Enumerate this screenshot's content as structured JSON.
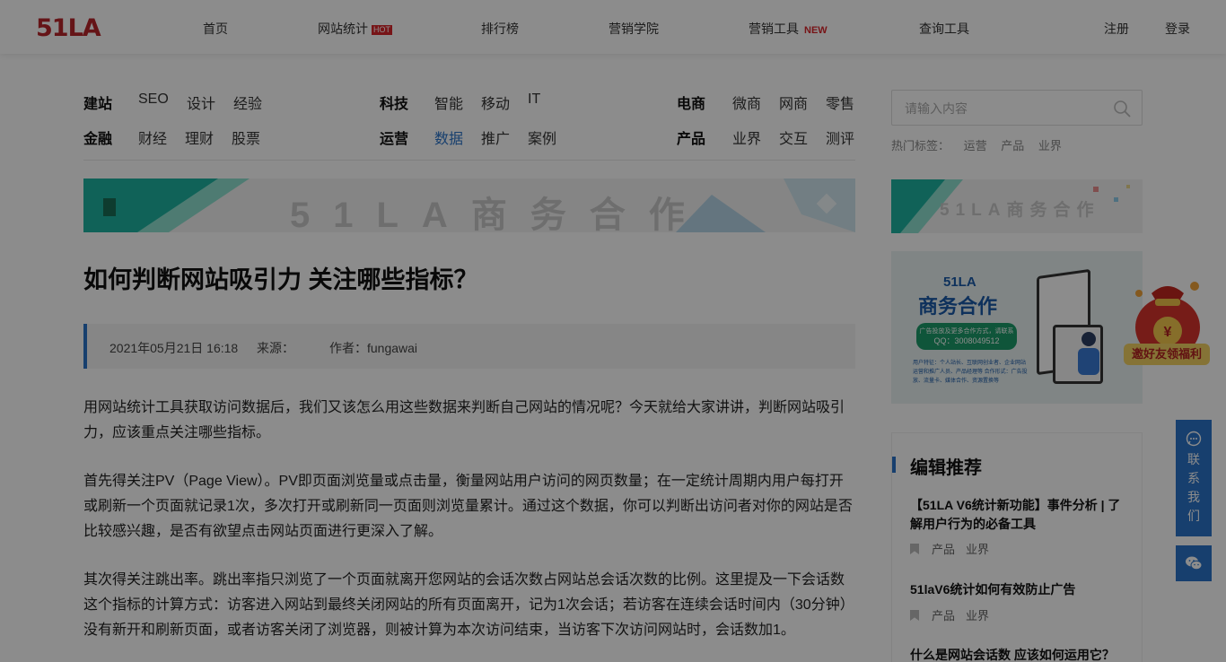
{
  "header": {
    "logo": "51LA",
    "nav": [
      {
        "label": "首页"
      },
      {
        "label": "网站统计",
        "badge": "HOT"
      },
      {
        "label": "排行榜"
      },
      {
        "label": "营销学院"
      },
      {
        "label": "营销工具",
        "badge": "NEW"
      },
      {
        "label": "查询工具"
      }
    ],
    "register": "注册",
    "login": "登录"
  },
  "categories": {
    "row1": {
      "g1": {
        "head": "建站",
        "items": [
          "SEO",
          "设计",
          "经验"
        ]
      },
      "g2": {
        "head": "科技",
        "items": [
          "智能",
          "移动",
          "IT"
        ]
      },
      "g3": {
        "head": "电商",
        "items": [
          "微商",
          "网商",
          "零售"
        ]
      }
    },
    "row2": {
      "g1": {
        "head": "金融",
        "items": [
          "财经",
          "理财",
          "股票"
        ]
      },
      "g2": {
        "head": "运营",
        "items": [
          "数据",
          "推广",
          "案例"
        ]
      },
      "g3": {
        "head": "产品",
        "items": [
          "业界",
          "交互",
          "测评"
        ]
      }
    },
    "active": "数据"
  },
  "search": {
    "placeholder": "请输入内容",
    "hot_label": "热门标签：",
    "hot_tags": [
      "运营",
      "产品",
      "业界"
    ]
  },
  "banner": {
    "main_text": "51LA商务合作",
    "side_text": "51LA商务合作"
  },
  "article": {
    "title": "如何判断网站吸引力 关注哪些指标？",
    "date": "2021年05月21日 16:18",
    "source_label": "来源：",
    "author_label": "作者：fungawai",
    "paragraphs": [
      "用网站统计工具获取访问数据后，我们又该怎么用这些数据来判断自己网站的情况呢？今天就给大家讲讲，判断网站吸引力，应该重点关注哪些指标。",
      "首先得关注PV（Page View）。PV即页面浏览量或点击量，衡量网站用户访问的网页数量；在一定统计周期内用户每打开或刷新一个页面就记录1次，多次打开或刷新同一页面则浏览量累计。通过这个数据，你可以判断出访问者对你的网站是否比较感兴趣，是否有欲望点击网站页面进行更深入了解。",
      "其次得关注跳出率。跳出率指只浏览了一个页面就离开您网站的会话次数占网站总会话次数的比例。这里提及一下会话数这个指标的计算方式：访客进入网站到最终关闭网站的所有页面离开，记为1次会话；若访客在连续会话时间内（30分钟）没有新开和刷新页面，或者访客关闭了浏览器，则被计算为本次访问结束，当访客下次访问网站时，会话数加1。"
    ]
  },
  "ad": {
    "brand": "51LA",
    "title": "商务合作",
    "contact_line": "广告投放及更多合作方式，请联系",
    "qq": "QQ：3008049512",
    "small_text": "用户特征：个人站长、互联网创业者、企业网站运营和推广人员、产品经理等 合作形式：广告投放、流量卡、媒体合作、资源置换等",
    "gift_label": "邀好友领福利",
    "gift_symbol": "¥"
  },
  "recommend": {
    "heading": "编辑推荐",
    "items": [
      {
        "title": "【51LA V6统计新功能】事件分析 | 了解用户行为的必备工具",
        "tags": [
          "产品",
          "业界"
        ]
      },
      {
        "title": "51laV6统计如何有效防止广告",
        "tags": [
          "产品",
          "业界"
        ]
      },
      {
        "title": "什么是网站会话数 应该如何运用它？",
        "tags": []
      }
    ]
  },
  "float": {
    "contact_chars": [
      "联",
      "系",
      "我",
      "们"
    ]
  },
  "colors": {
    "brand_red": "#b8252b",
    "accent_blue": "#2a73c9",
    "overlay": "rgba(0,0,0,0.45)"
  }
}
